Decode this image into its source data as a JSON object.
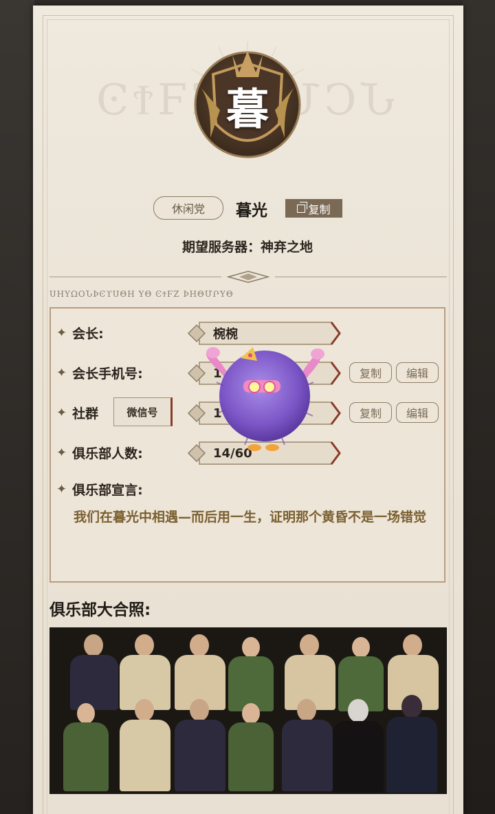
{
  "header": {
    "emblem_char": "暮",
    "watermark": "ϾϮϜΖ ϴՄϽՆ",
    "tag": "休闲党",
    "club_name": "暮光",
    "copy_label": "复制",
    "server_line": "期望服务器：神弃之地",
    "runes": "ՍΗΥΩΟՆϷϾϒՍΘΗ ΥΘ ϾϮϜΖ ϷΗΘՄՐΥΘ"
  },
  "info": {
    "leader_label": "会长:",
    "leader_value": "椀椀",
    "phone_label": "会长手机号:",
    "phone_value": "1",
    "phone_value_tail": "1",
    "community_label": "社群",
    "wechat_tag": "微信号",
    "community_value": "1",
    "members_label": "俱乐部人数:",
    "members_value": "14/60",
    "declaration_label": "俱乐部宣言:",
    "declaration_text": "我们在暮光中相遇—而后用一生，证明那个黄昏不是一场错觉",
    "copy_btn": "复制",
    "edit_btn": "编辑"
  },
  "photo": {
    "title": "俱乐部大合照:"
  },
  "colors": {
    "accent_brown": "#7a6a55",
    "manifesto_gold": "#7a5f30",
    "paper": "#ece5d8",
    "mascot_purple": "#8a5fd0"
  }
}
